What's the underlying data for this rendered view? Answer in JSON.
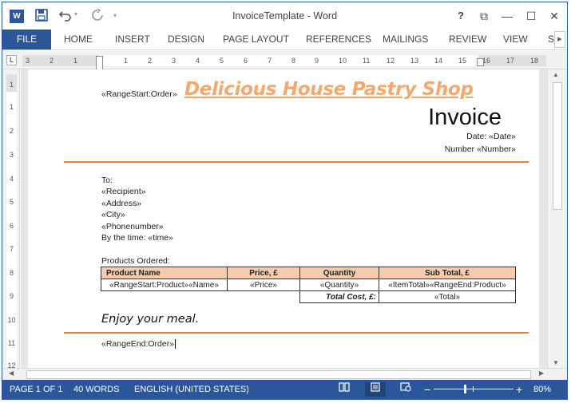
{
  "window": {
    "title": "InvoiceTemplate - Word",
    "app_logo": "W",
    "icons": {
      "save": "save-icon",
      "undo": "undo-icon",
      "redo": "redo-icon",
      "customize": "customize-qat-icon"
    },
    "controls": {
      "help": "?",
      "ribbon_display": "⧉",
      "minimize": "—",
      "restore": "☐",
      "close": "✕"
    }
  },
  "ribbon": {
    "tabs": [
      "FILE",
      "HOME",
      "INSERT",
      "DESIGN",
      "PAGE LAYOUT",
      "REFERENCES",
      "MAILINGS",
      "REVIEW",
      "VIEW",
      "SI"
    ],
    "accent": "#2b579a"
  },
  "ruler": {
    "tab_selector": "L",
    "h_numbers": [
      "3",
      "2",
      "1",
      "1",
      "2",
      "3",
      "4",
      "5",
      "6",
      "7",
      "8",
      "9",
      "10",
      "11",
      "12",
      "13",
      "14",
      "15",
      "16",
      "17",
      "18"
    ],
    "v_numbers": [
      "1",
      "1",
      "2",
      "3",
      "4",
      "5",
      "6",
      "7",
      "8",
      "9",
      "10",
      "11",
      "12"
    ]
  },
  "document": {
    "range_start_order": "«RangeStart:Order»",
    "shop_name": "Delicious House Pastry Shop",
    "invoice_title": "Invoice",
    "date_line": "Date: «Date»",
    "number_line": "Number  «Number»",
    "to_label": "To:",
    "recipient": "«Recipient»",
    "address": "«Address»",
    "city": "«City»",
    "phone": "«Phonenumber»",
    "by_time": "By the time: «time»",
    "products_label": "Products Ordered:",
    "table": {
      "headers": [
        "Product Name",
        "Price, £",
        "Quantity",
        "Sub Total, £"
      ],
      "row": [
        "«RangeStart:Product»«Name»",
        "«Price»",
        "«Quantity»",
        "«ItemTotal»«RangeEnd:Product»"
      ],
      "total_label": "Total Cost, £:",
      "total_value": "«Total»"
    },
    "enjoy": "Enjoy your meal.",
    "range_end_order": "«RangeEnd:Order»",
    "accent_line_color": "#ed7d31",
    "shop_name_color": "#f5a86b",
    "header_fill": "#f8cbad"
  },
  "statusbar": {
    "page": "PAGE 1 OF 1",
    "words": "40 WORDS",
    "language": "ENGLISH (UNITED STATES)",
    "zoom_minus": "−",
    "zoom_plus": "+",
    "zoom": "80%",
    "zoom_percent": 80
  }
}
